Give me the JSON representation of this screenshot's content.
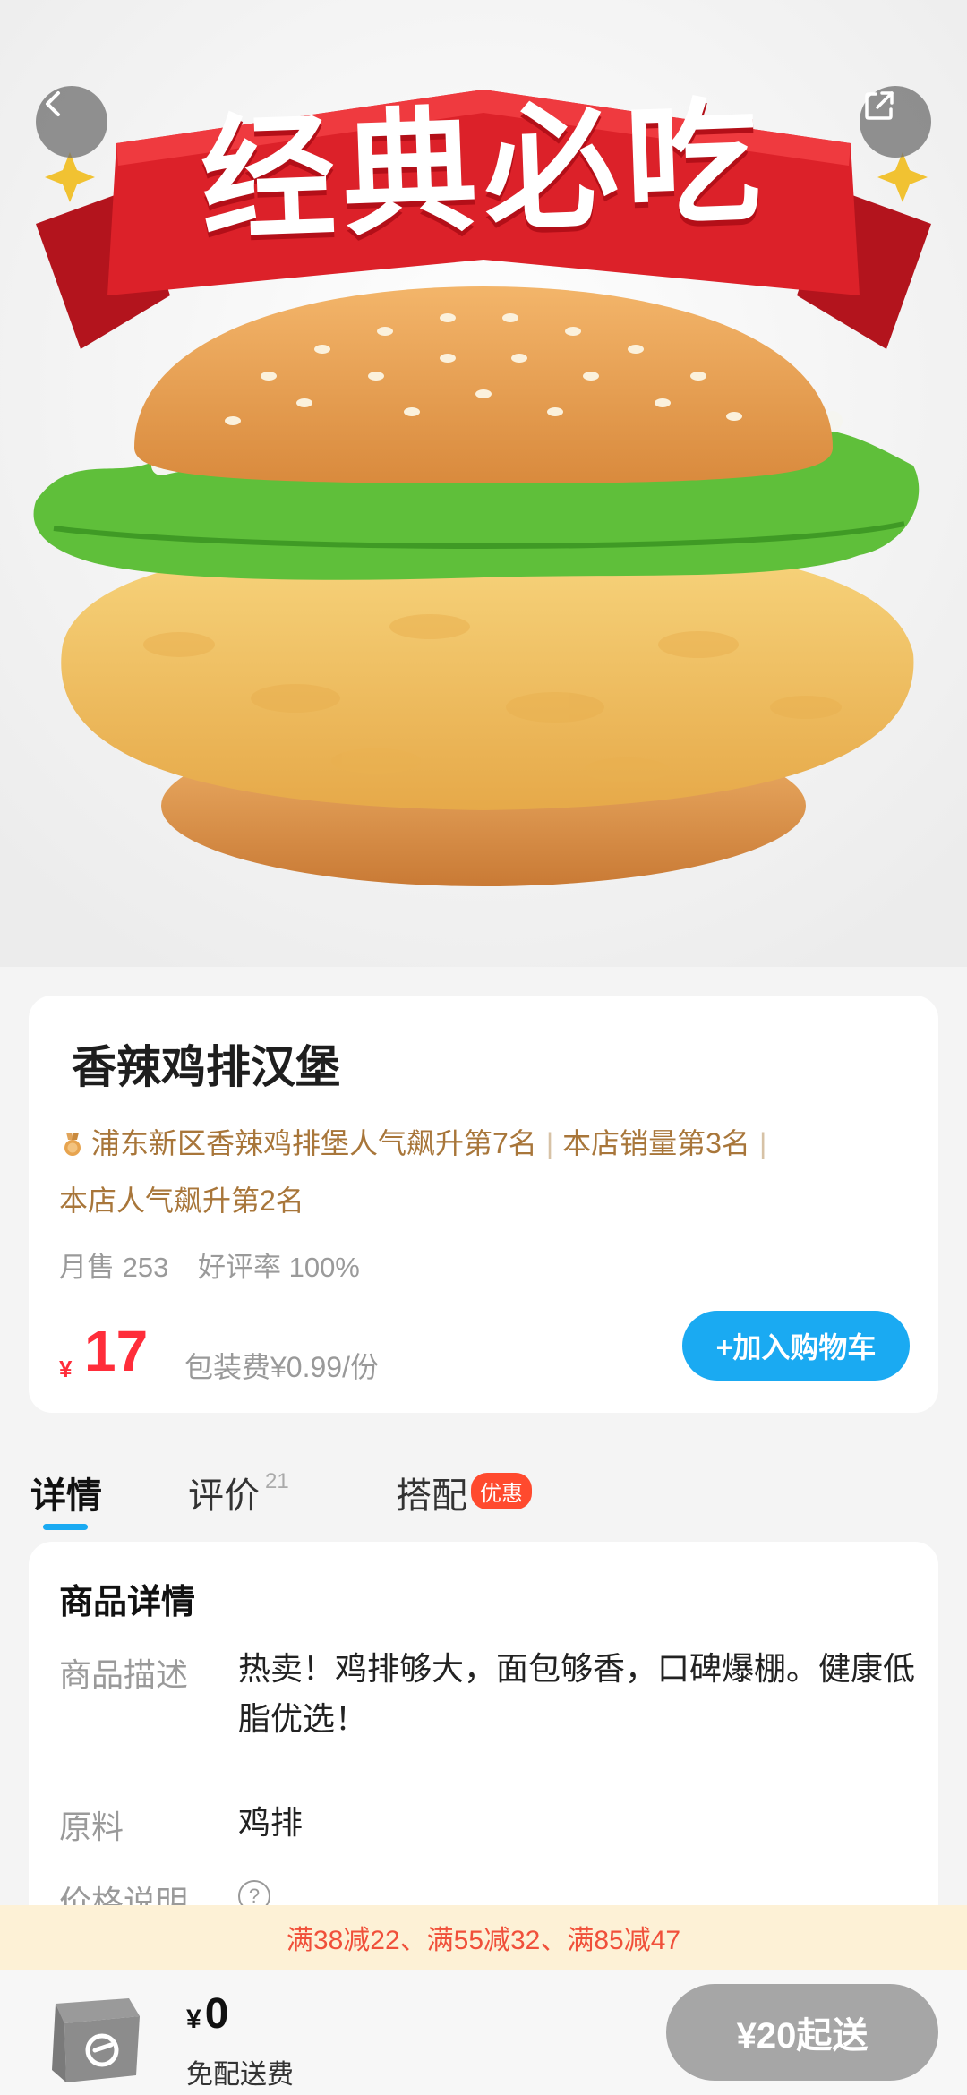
{
  "hero": {
    "banner_text": "经典必吃",
    "back_icon": "chevron-left-icon",
    "share_icon": "share-external-icon",
    "colors": {
      "ribbon": "#d7202a",
      "bun": "#e9a55a",
      "lettuce": "#5fbf3a",
      "patty": "#f2c263"
    }
  },
  "product": {
    "name": "香辣鸡排汉堡",
    "rank_parts": [
      "浦东新区香辣鸡排堡人气飙升第7名",
      "本店销量第3名"
    ],
    "rank_line2": "本店人气飙升第2名",
    "monthly_sales": "月售 253",
    "rating": "好评率 100%",
    "currency": "¥",
    "price": "17",
    "packaging_fee": "包装费¥0.99/份",
    "add_to_cart_label": "+加入购物车",
    "accent_color": "#1aaaf2",
    "price_color": "#ff2d3a"
  },
  "tabs": {
    "detail": "详情",
    "review": "评价",
    "review_count": "21",
    "combo": "搭配",
    "combo_badge": "优惠"
  },
  "details": {
    "heading": "商品详情",
    "desc_label": "商品描述",
    "desc_value": "热卖！鸡排够大，面包够香，口碑爆棚。健康低脂优选！",
    "ingredient_label": "原料",
    "ingredient_value": "鸡排",
    "price_note_label": "价格说明",
    "help_icon": "question-circle-icon"
  },
  "promo": {
    "text": "满38减22、满55减32、满85减47"
  },
  "bottom_bar": {
    "cart_icon": "shopping-bag-icon",
    "currency": "¥",
    "total": "0",
    "delivery": "免配送费",
    "min_order_label": "¥20起送"
  }
}
